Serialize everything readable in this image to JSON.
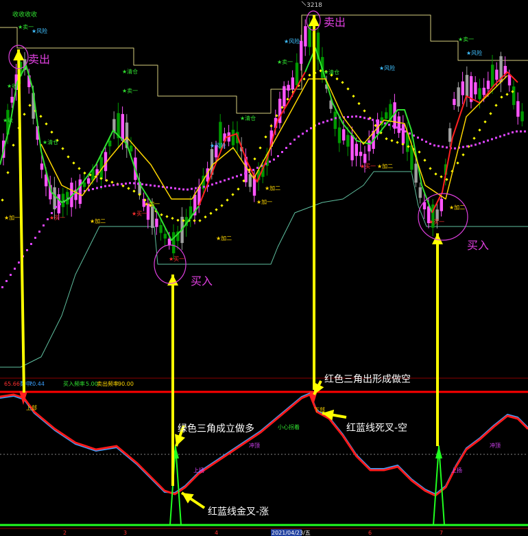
{
  "chart_data": [
    {
      "type": "candlestick",
      "peak_label": "3218",
      "annotations": [
        {
          "text": "卖出",
          "color": "#e040e0",
          "position": "top-left"
        },
        {
          "text": "卖出",
          "color": "#e040e0",
          "position": "top-center"
        },
        {
          "text": "买入",
          "color": "#e040e0",
          "position": "middle-left"
        },
        {
          "text": "买入",
          "color": "#e040e0",
          "position": "middle-right"
        }
      ],
      "signal_labels": {
        "sell_one": "卖一",
        "buy_one": "买一",
        "clear": "清仓",
        "risk": "风险",
        "add_two": "加二",
        "add_one": "加一",
        "collect": "收",
        "top_mark": "收收收收"
      },
      "colors": {
        "up_candle": "#ff55ff",
        "down_candle": "#009900",
        "gray_candle": "#a0a0a0",
        "ma_red": "#ff2020",
        "ma_green": "#30e030",
        "ma_yellow": "#ffd700",
        "dots_yellow": "#ffff00",
        "dots_magenta": "#dd44ff",
        "band_khaki": "#d8d080",
        "band_teal": "#60c0a0",
        "arrow": "#ffff00"
      }
    },
    {
      "type": "line",
      "header": {
        "v1": "65.66",
        "v2_label": "数中:",
        "v2": "70.44",
        "v3_label": "买入频率",
        "v3": "5.00",
        "v4_label": "卖出频率",
        "v4": "90.00"
      },
      "series": [
        {
          "color": "#ff1a1a"
        },
        {
          "color": "#3aa0ff"
        },
        {
          "color": "#20ff20"
        }
      ],
      "threshold_lines": [
        {
          "color": "#ff0000"
        }
      ],
      "inline_labels": [
        "上部",
        "小心拐着",
        "冲顶",
        "上扬",
        "冲顶",
        "上扬",
        "下部"
      ],
      "annotations": [
        "红色三角出形成做空",
        "红蓝线死叉-空",
        "绿色三角成立做多",
        "红蓝线金叉-涨"
      ],
      "x_ticks": [
        "2",
        "3",
        "4",
        "2021/04/23/五",
        "6",
        "7"
      ]
    }
  ]
}
